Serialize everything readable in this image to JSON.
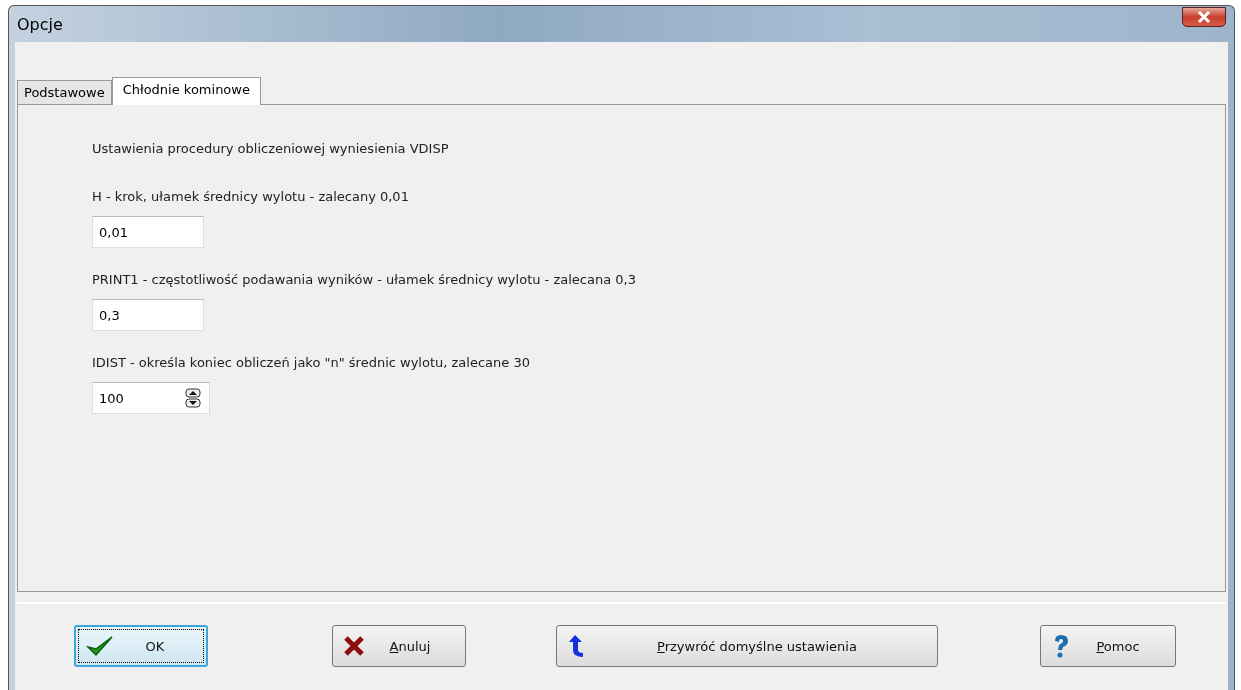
{
  "window": {
    "title": "Opcje"
  },
  "tabs": [
    {
      "label": "Podstawowe",
      "selected": false
    },
    {
      "label": "Chłodnie kominowe",
      "selected": true
    }
  ],
  "heading": "Ustawienia procedury obliczeniowej wyniesienia VDISP",
  "fields": [
    {
      "kind": "text",
      "label": "H - krok, ułamek średnicy wylotu - zalecany 0,01",
      "value": "0,01"
    },
    {
      "kind": "text",
      "label": "PRINT1 - częstotliwość podawania wyników -  ułamek średnicy wylotu - zalecana 0,3",
      "value": "0,3"
    },
    {
      "kind": "spinner",
      "label": "IDIST - określa koniec obliczeń jako \"n\" średnic wylotu, zalecane 30",
      "value": "100"
    }
  ],
  "buttons": [
    {
      "kind": "ok",
      "label": "OK",
      "focused": true,
      "mnemonic": false
    },
    {
      "kind": "cancel",
      "label": "Anuluj",
      "focused": false,
      "mnemonic": true
    },
    {
      "kind": "reset",
      "label": "Przywróć domyślne ustawienia",
      "focused": false,
      "mnemonic": true
    },
    {
      "kind": "help",
      "label": "Pomoc",
      "focused": false,
      "mnemonic": true
    }
  ]
}
